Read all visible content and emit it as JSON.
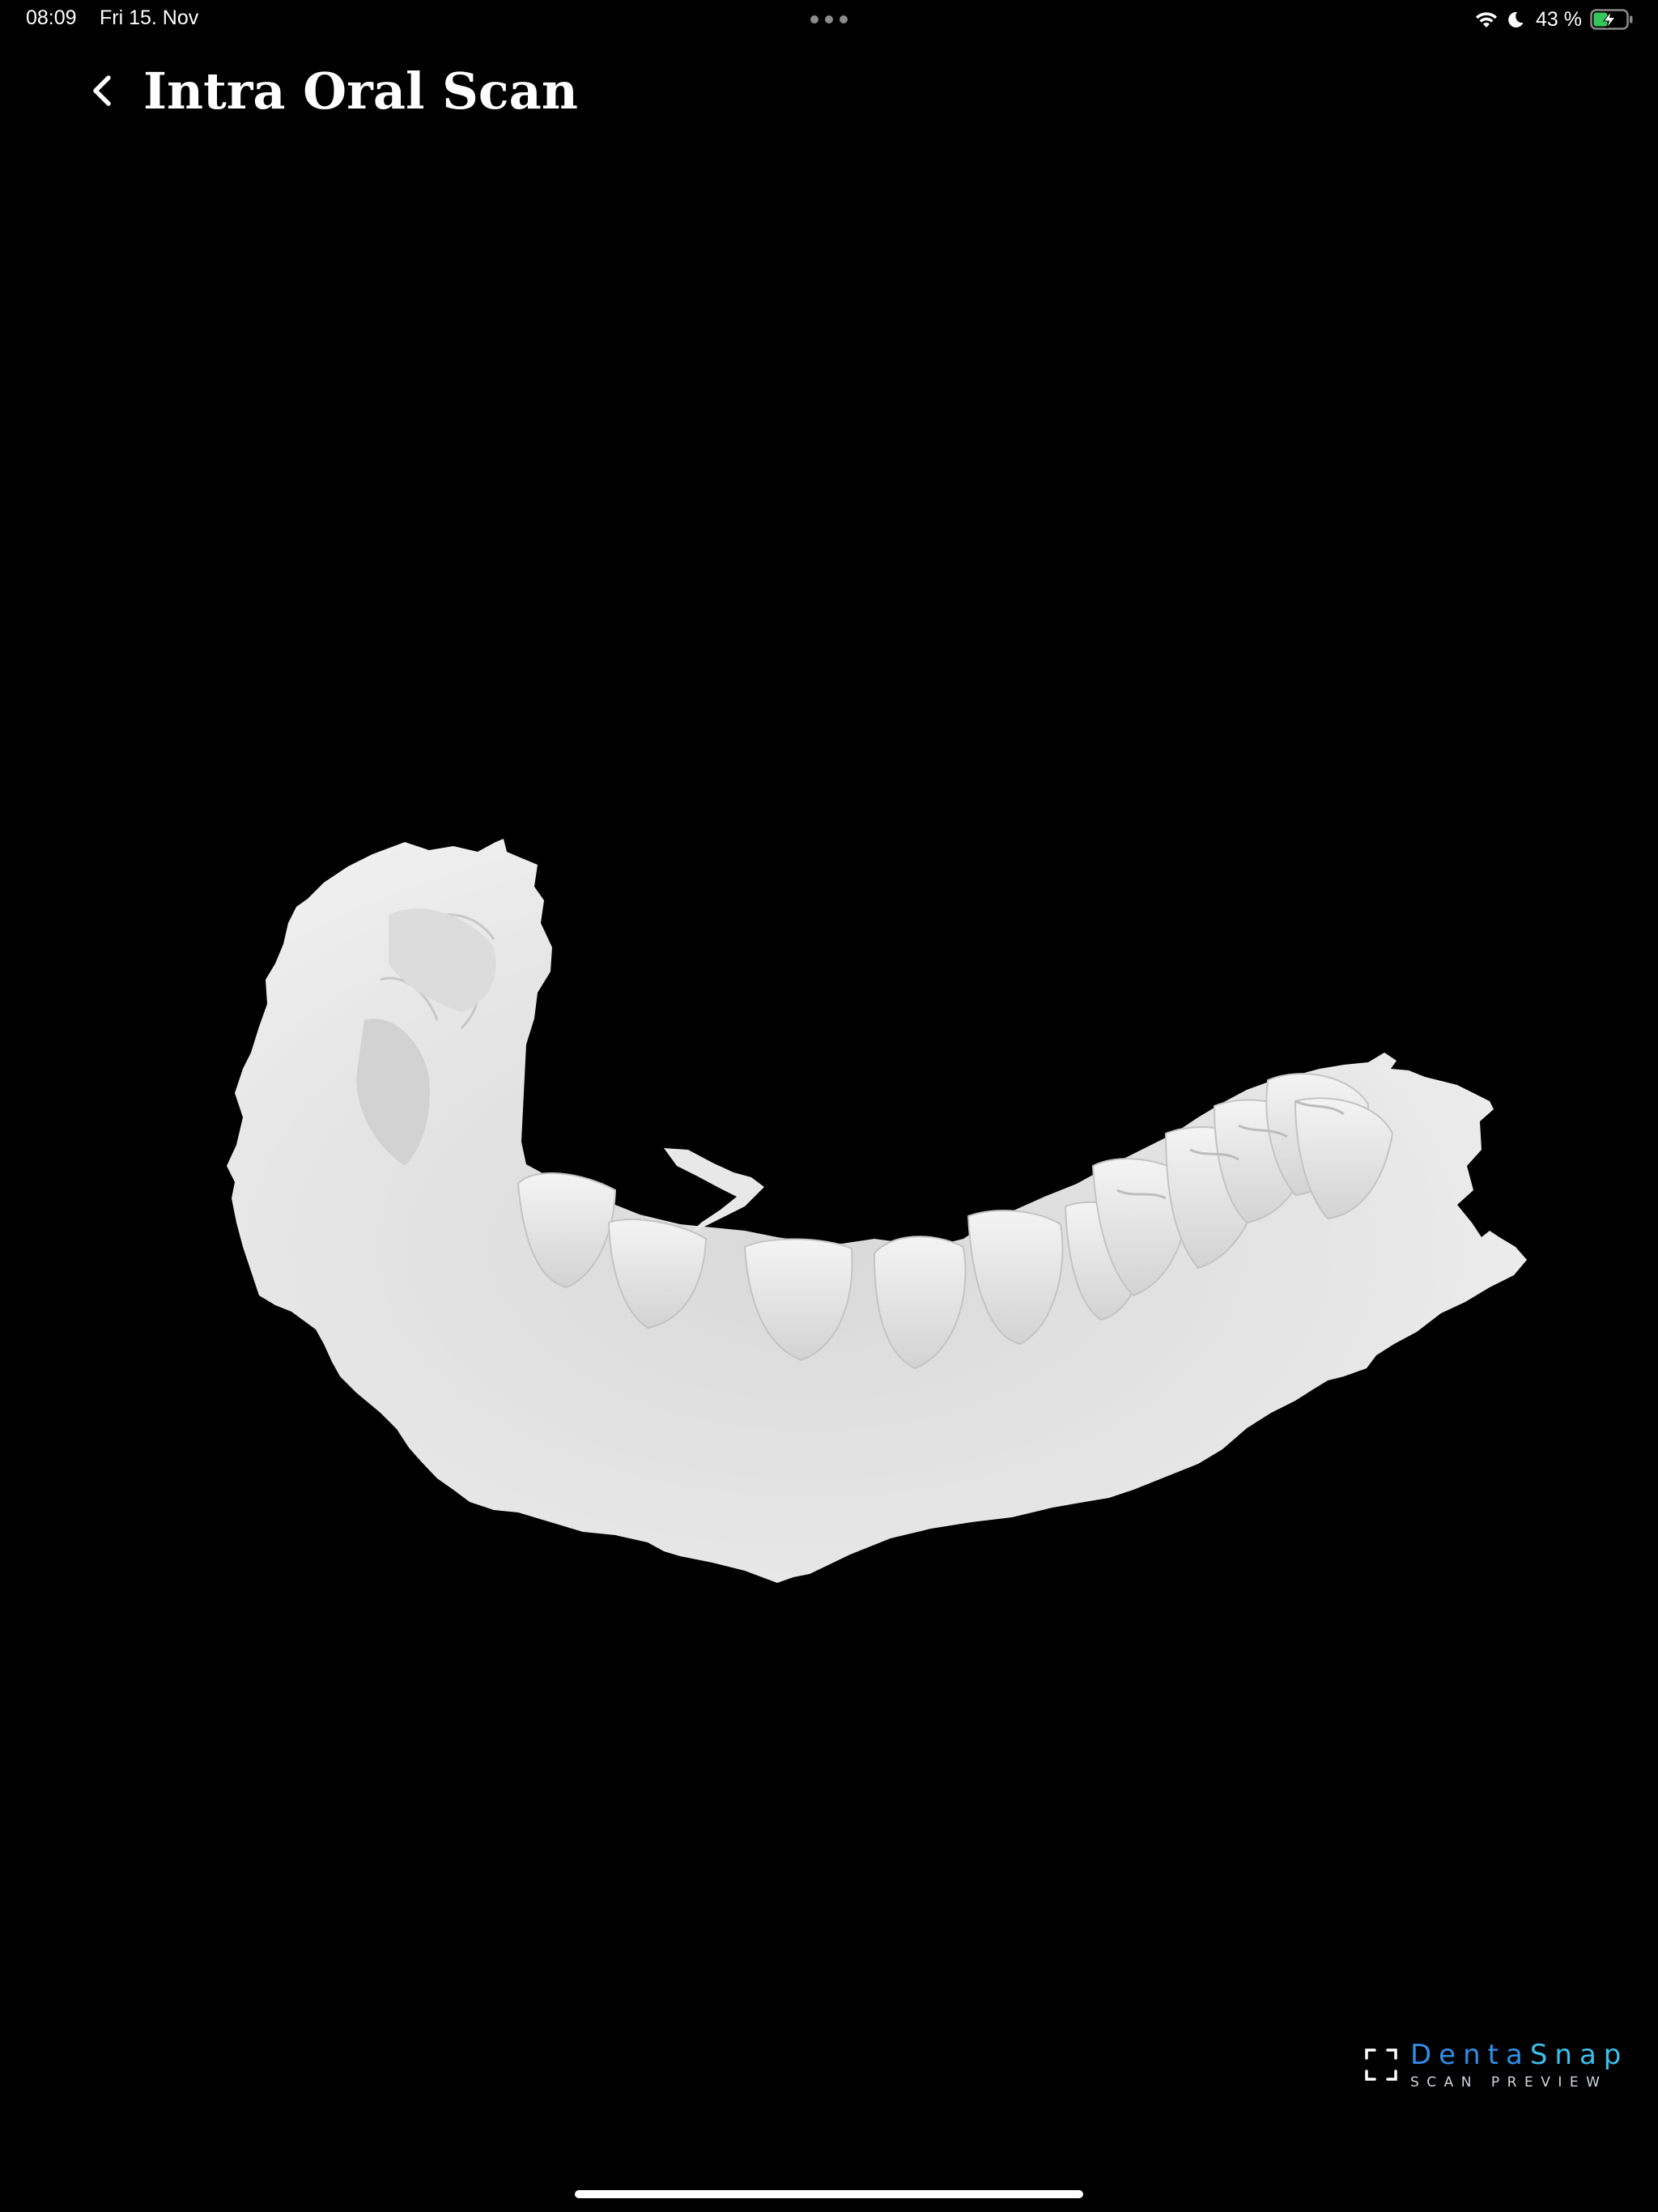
{
  "status_bar": {
    "time": "08:09",
    "date": "Fri 15. Nov",
    "battery_percent": "43 %",
    "battery_level": 0.43,
    "battery_charging": true,
    "icons": [
      "wifi-icon",
      "moon-icon",
      "battery-charging-icon"
    ]
  },
  "header": {
    "back_icon": "chevron-left-icon",
    "title": "Intra Oral Scan"
  },
  "viewer": {
    "model": "lower-jaw-scan-mesh",
    "background": "#000000",
    "model_color": "#e4e4e4"
  },
  "watermark": {
    "brand_part1": "Denta",
    "brand_part2": "Snap",
    "subtitle": "SCAN PREVIEW",
    "icon": "scan-frame-icon",
    "brand_color": "#2f8fe8",
    "accent_color": "#3cc0ee"
  },
  "colors": {
    "battery_charge": "#34c759",
    "text": "#ffffff"
  }
}
